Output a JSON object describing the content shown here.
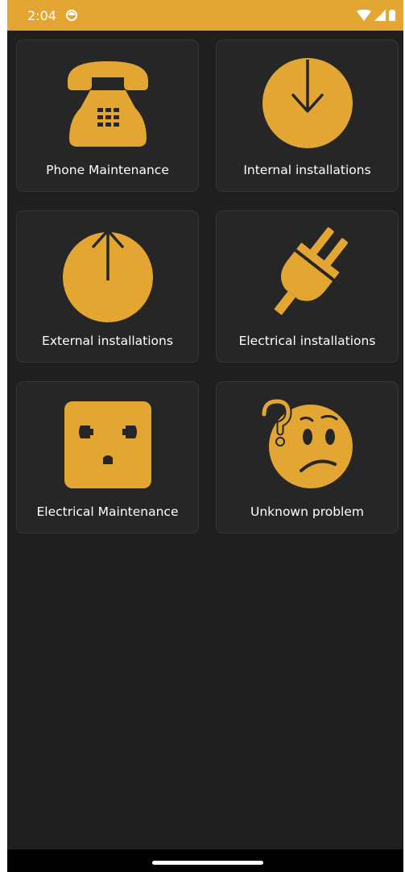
{
  "status": {
    "time": "2:04"
  },
  "colors": {
    "accent": "#e3a633",
    "background": "#1f1f1f",
    "card": "#262626",
    "text": "#ffffff"
  },
  "tiles": [
    {
      "label": "Phone Maintenance",
      "icon": "telephone-icon"
    },
    {
      "label": "Internal installations",
      "icon": "arrow-down-circle-icon"
    },
    {
      "label": "External installations",
      "icon": "arrow-up-circle-icon"
    },
    {
      "label": "Electrical installations",
      "icon": "plug-icon"
    },
    {
      "label": "Electrical Maintenance",
      "icon": "socket-icon"
    },
    {
      "label": "Unknown problem",
      "icon": "confused-face-icon"
    }
  ]
}
